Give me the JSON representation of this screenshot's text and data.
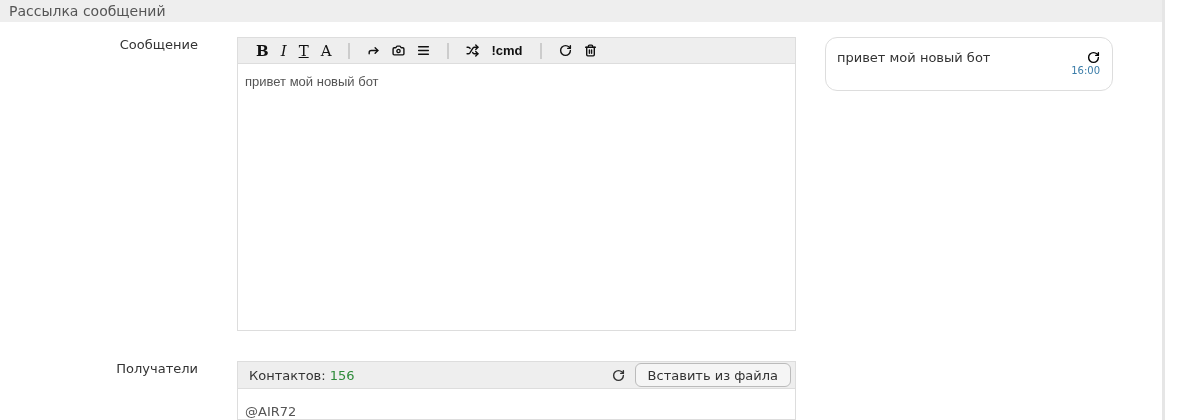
{
  "panel": {
    "title": "Рассылка сообщений"
  },
  "message": {
    "label": "Сообщение",
    "toolbar": [
      [
        {
          "kind": "bold",
          "label": "B"
        },
        {
          "kind": "italic",
          "label": "I"
        },
        {
          "kind": "strike",
          "label": "T"
        },
        {
          "kind": "font",
          "label": "A"
        }
      ],
      [
        {
          "kind": "forward"
        },
        {
          "kind": "camera"
        },
        {
          "kind": "list"
        }
      ],
      [
        {
          "kind": "shuffle"
        },
        {
          "kind": "command",
          "label": "!cmd"
        }
      ],
      [
        {
          "kind": "refresh"
        },
        {
          "kind": "delete"
        }
      ]
    ],
    "text": "привет мой новый бот"
  },
  "preview": {
    "text": "привет мой новый бот",
    "time": "16:00"
  },
  "recipients": {
    "label": "Получатели",
    "count_label": "Контактов:",
    "count": "156",
    "button": "Вставить из файла",
    "value": "@AIR72"
  }
}
